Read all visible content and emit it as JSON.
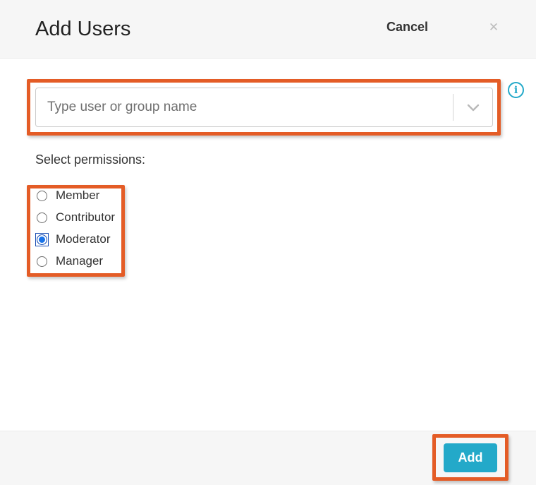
{
  "dialog": {
    "title": "Add Users",
    "close_icon": "✕"
  },
  "user_picker": {
    "value": "",
    "placeholder": "Type user or group name",
    "chevron_icon": "chevron-down",
    "info_icon_glyph": "i"
  },
  "permissions": {
    "label": "Select permissions:",
    "options": [
      {
        "label": "Member",
        "selected": false
      },
      {
        "label": "Contributor",
        "selected": false
      },
      {
        "label": "Moderator",
        "selected": true
      },
      {
        "label": "Manager",
        "selected": false
      }
    ]
  },
  "footer": {
    "cancel_label": "Cancel",
    "add_label": "Add"
  },
  "annotations": {
    "highlight_color": "#E45C26",
    "highlighted_elements": [
      "user-picker-combo",
      "permissions-radio-group",
      "add-button"
    ]
  },
  "colors": {
    "annotation_orange": "#E45C26",
    "primary_teal": "#23A9C9",
    "radio_selected_blue": "#1a73e8",
    "header_bg": "#f6f6f6"
  }
}
